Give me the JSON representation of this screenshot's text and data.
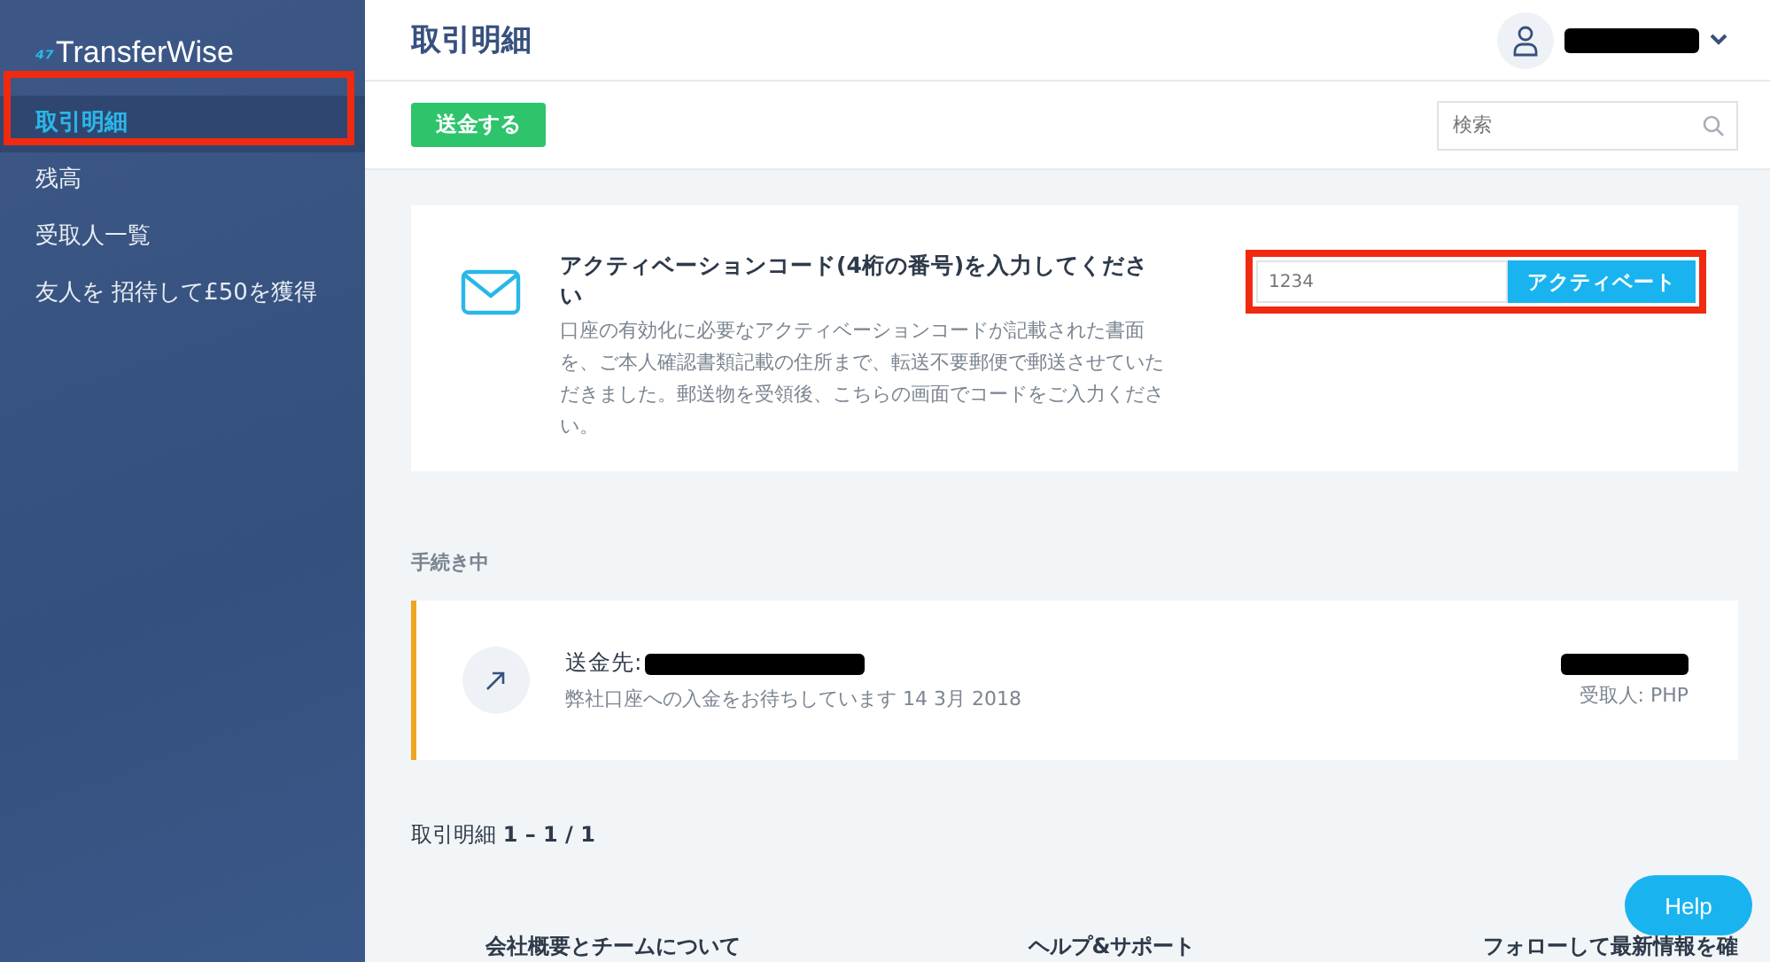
{
  "sidebar": {
    "logo_mark": "⁴⁷",
    "logo": "TransferWise",
    "items": [
      {
        "label": "取引明細",
        "selected": true
      },
      {
        "label": "残高",
        "selected": false
      },
      {
        "label": "受取人一覧",
        "selected": false
      },
      {
        "label": "友人を 招待して£50を獲得",
        "selected": false
      }
    ]
  },
  "header": {
    "title": "取引明細"
  },
  "toolbar": {
    "send_button": "送金する",
    "search": {
      "placeholder": "検索"
    }
  },
  "activation": {
    "title": "アクティベーションコード(4桁の番号)を入力してください",
    "body": "口座の有効化に必要なアクティベーションコードが記載された書面を、ご本人確認書類記載の住所まで、転送不要郵便で郵送させていただきました。郵送物を受領後、こちらの画面でコードをご入力ください。",
    "code": {
      "placeholder": "1234"
    },
    "button": "アクティベート"
  },
  "pending": {
    "heading": "手続き中",
    "transfer": {
      "to_label": "送金先:",
      "status": "弊社口座への入金をお待ちしています 14 3月 2018",
      "recipient": "受取人: PHP"
    }
  },
  "history": {
    "summary": "取引明細 **1 – 1 / 1**"
  },
  "footer": {
    "columns": [
      "会社概要とチームについて",
      "ヘルプ&サポート",
      "フォローして最新情報を確"
    ]
  },
  "help_button": "Help"
}
